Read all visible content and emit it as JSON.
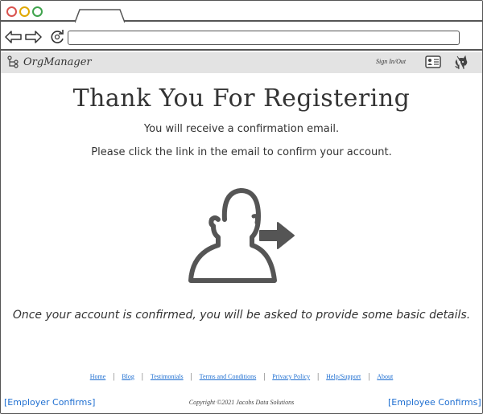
{
  "browser": {
    "window_controls": [
      "close",
      "minimize",
      "maximize"
    ],
    "url": "",
    "colors": {
      "close": "#d9534f",
      "minimize": "#e0a800",
      "maximize": "#3fa34d"
    }
  },
  "header": {
    "brand": "OrgManager",
    "sign_in": "Sign In/Out",
    "icons": [
      "hierarchy-icon",
      "id-card-icon",
      "github-icon"
    ],
    "background": "#e3e3e3"
  },
  "main": {
    "title": "Thank You For Registering",
    "line1": "You will receive a confirmation email.",
    "line2": "Please click the link in the email to confirm your account.",
    "illustration_icon": "user-arrow-icon",
    "note": "Once your account is confirmed, you will be asked to provide some basic details."
  },
  "footer": {
    "links": [
      "Home",
      "Blog",
      "Testimonials",
      "Terms and Conditions",
      "Privacy Policy",
      "Help/Support",
      "About"
    ],
    "copyright": "Copyright ©2021 Jacobs Data Solutions",
    "left_link": "[Employer Confirms]",
    "right_link": "[Employee Confirms]",
    "link_color": "#1f6fd1"
  }
}
